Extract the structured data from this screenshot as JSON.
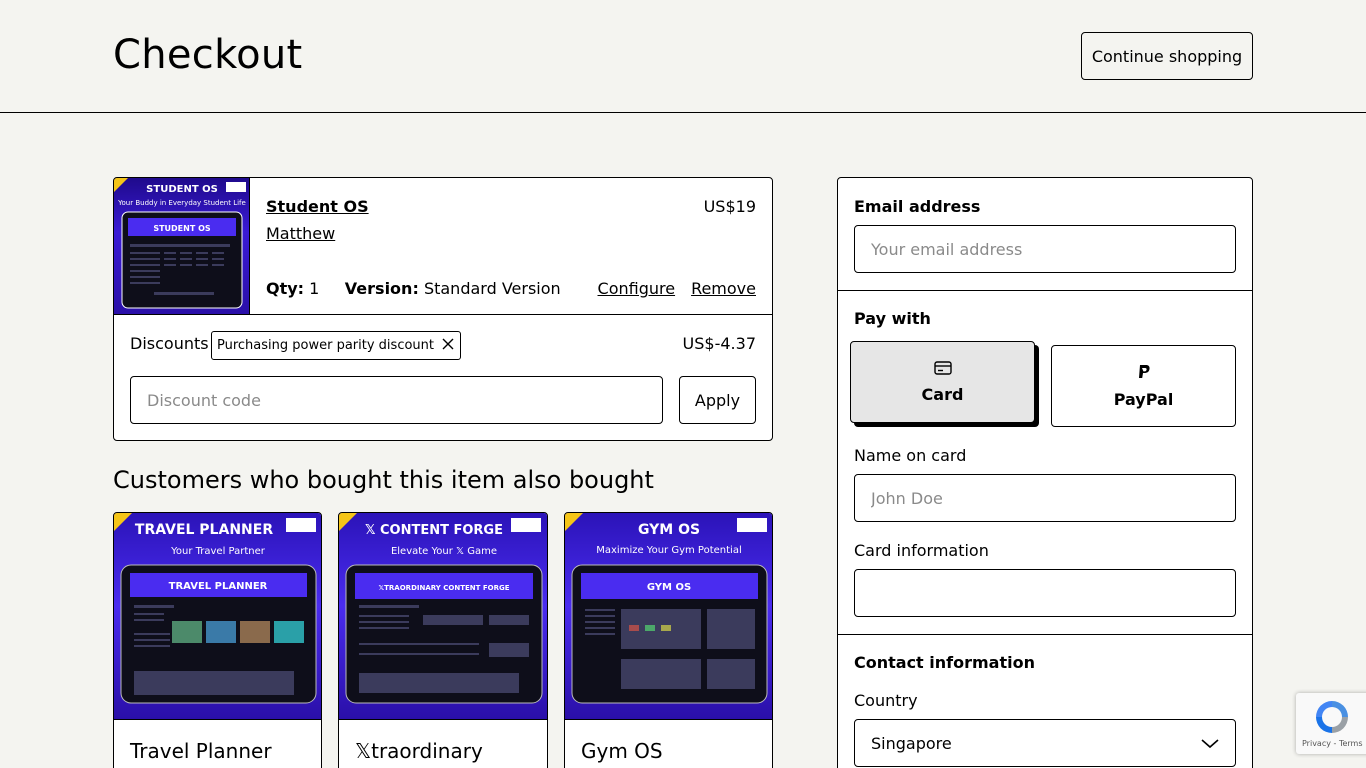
{
  "header": {
    "title": "Checkout",
    "continue_label": "Continue shopping"
  },
  "cart": {
    "item": {
      "thumb_title": "STUDENT OS",
      "thumb_subtitle": "Your Buddy in Everyday Student Life",
      "thumb_screen_title": "STUDENT OS",
      "name": "Student OS",
      "seller": "Matthew",
      "price": "US$19",
      "qty_label": "Qty:",
      "qty_value": "1",
      "version_label": "Version:",
      "version_value": "Standard Version",
      "configure_label": "Configure",
      "remove_label": "Remove"
    },
    "discounts": {
      "label": "Discounts",
      "chip_label": "Purchasing power parity discount",
      "amount": "US$-4.37",
      "input_placeholder": "Discount code",
      "apply_label": "Apply"
    }
  },
  "recommendations": {
    "heading": "Customers who bought this item also bought",
    "items": [
      {
        "title": "Travel Planner",
        "image_title": "TRAVEL PLANNER",
        "image_subtitle": "Your Travel Partner",
        "screen_title": "TRAVEL PLANNER"
      },
      {
        "title": "𝕏traordinary",
        "image_title": "𝕏 CONTENT FORGE",
        "image_subtitle": "Elevate Your 𝕏 Game",
        "screen_title": "𝕏TRAORDINARY CONTENT FORGE"
      },
      {
        "title": "Gym OS",
        "image_title": "GYM OS",
        "image_subtitle": "Maximize Your Gym Potential",
        "screen_title": "GYM OS"
      }
    ]
  },
  "form": {
    "email_label": "Email address",
    "email_placeholder": "Your email address",
    "pay_with_label": "Pay with",
    "pay_options": [
      {
        "label": "Card",
        "icon": "card-icon",
        "selected": true
      },
      {
        "label": "PayPal",
        "icon": "paypal-icon",
        "selected": false
      }
    ],
    "name_label": "Name on card",
    "name_placeholder": "John Doe",
    "card_info_label": "Card information",
    "contact_label": "Contact information",
    "country_label": "Country",
    "country_value": "Singapore"
  },
  "recaptcha": {
    "links": "Privacy - Terms"
  }
}
